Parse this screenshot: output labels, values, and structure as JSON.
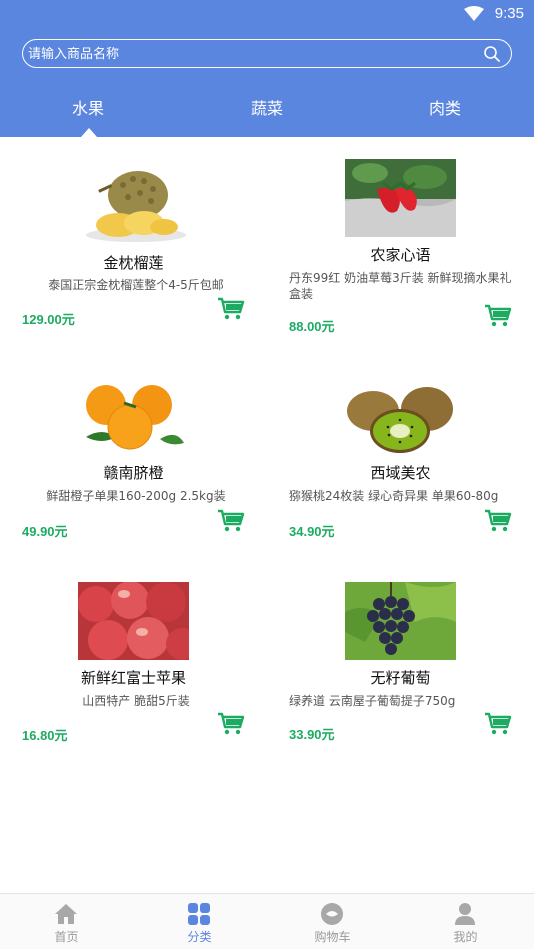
{
  "status": {
    "time": "9:35"
  },
  "search": {
    "placeholder": "请输入商品名称"
  },
  "tabs": [
    {
      "label": "水果",
      "active": true
    },
    {
      "label": "蔬菜",
      "active": false
    },
    {
      "label": "肉类",
      "active": false
    }
  ],
  "products": [
    {
      "name": "金枕榴莲",
      "desc": "泰国正宗金枕榴莲整个4-5斤包邮",
      "price": "129.00元",
      "image": "durian-image"
    },
    {
      "name": "农家心语",
      "desc": "丹东99红 奶油草莓3斤装 新鲜现摘水果礼盒装",
      "price": "88.00元",
      "image": "strawberry-image"
    },
    {
      "name": "赣南脐橙",
      "desc": "鲜甜橙子单果160-200g 2.5kg装",
      "price": "49.90元",
      "image": "orange-image"
    },
    {
      "name": "西域美农",
      "desc": "猕猴桃24枚装 绿心奇异果 单果60-80g",
      "price": "34.90元",
      "image": "kiwi-image"
    },
    {
      "name": "新鲜红富士苹果",
      "desc": "山西特产 脆甜5斤装",
      "price": "16.80元",
      "image": "apple-image"
    },
    {
      "name": "无籽葡萄",
      "desc": "绿养道 云南屋子葡萄提子750g",
      "price": "33.90元",
      "image": "grape-image"
    }
  ],
  "tabbar": [
    {
      "label": "首页",
      "icon": "home-icon",
      "active": false
    },
    {
      "label": "分类",
      "icon": "category-icon",
      "active": true
    },
    {
      "label": "购物车",
      "icon": "chat-cart-icon",
      "active": false
    },
    {
      "label": "我的",
      "icon": "user-icon",
      "active": false
    }
  ],
  "colors": {
    "header": "#5b86df",
    "price": "#1dab62",
    "cart": "#1dab62",
    "active_tab": "#5b86df",
    "inactive_tab": "#9a9a9a"
  }
}
